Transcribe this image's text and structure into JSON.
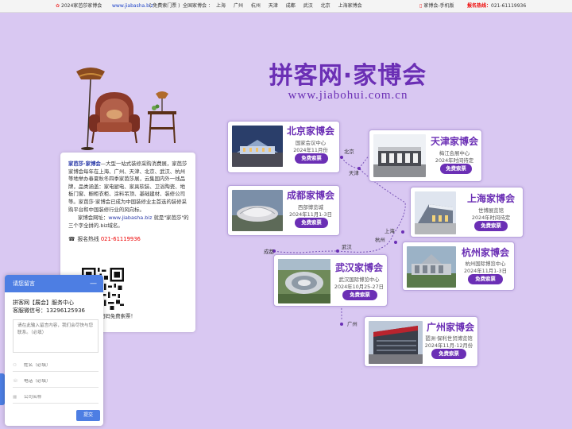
{
  "topbar": {
    "home": "2024家芭莎家博会",
    "site": "www.jiabasha.biz",
    "free": "( 免费索门票 )",
    "cities_label": "全国家博会 ：",
    "cities": [
      "上海",
      "广州",
      "杭州",
      "天津",
      "成都",
      "武汉",
      "北京",
      "上海家博会"
    ],
    "mobile": "家博会-手机版",
    "hotline_label": "报名热线：",
    "hotline_number": "021-61119936"
  },
  "hero": {
    "title": "拼客网·家博会",
    "url": "www.jiabohui.com.cn"
  },
  "about": {
    "brand": "家芭莎·家博会",
    "intro": "—大型一站式装修采购消费展，家芭莎家博会每年在上海、广州、天津、北京、武汉、杭州等地举办春夏秋冬四季家芭莎展，云集国内外一线品牌，品类涵盖：家电厨电、家具软装、卫浴陶瓷、地板门窗、橱柜衣柜、涂料吊顶、基础建材、装修公司等。家芭莎·家博会已成为中国装修业主首选的装修采购平台和中国装修行业的风向标。",
    "site_prefix": "家博会网址：",
    "site": "www.jiabasha.biz",
    "site_suffix": " 就是\"家芭莎\"的三个字全拼的.biz域名。",
    "hotline_label": "报名热线",
    "hotline_number": "021-61119936",
    "qr_caption": "扫码免费索票！"
  },
  "cards": [
    {
      "id": "beijing",
      "name": "北京家博会",
      "venue": "国家会议中心",
      "date": "2024年11月份",
      "button": "免费索票"
    },
    {
      "id": "tianjin",
      "name": "天津家博会",
      "venue": "梅江会展中心",
      "date": "2024年时间待定",
      "button": "免费索票"
    },
    {
      "id": "chengdu",
      "name": "成都家博会",
      "venue": "西部博览城",
      "date": "2024年11月1-3日",
      "button": "免费索票"
    },
    {
      "id": "shanghai",
      "name": "上海家博会",
      "venue": "世博展览馆",
      "date": "2024年时间待定",
      "button": "免费索票"
    },
    {
      "id": "hangzhou",
      "name": "杭州家博会",
      "venue": "杭州国际博览中心",
      "date": "2024年11月1-3日",
      "button": "免费索票"
    },
    {
      "id": "wuhan",
      "name": "武汉家博会",
      "venue": "武汉国际博览中心",
      "date": "2024年10月25-27日",
      "button": "免费索票"
    },
    {
      "id": "guangzhou",
      "name": "广州家博会",
      "venue": "琶洲·保利世贸博览馆",
      "date": "2024年11月-12月份",
      "button": "免费索票"
    }
  ],
  "map_labels": {
    "beijing": "北京",
    "tianjin": "天津",
    "shanghai": "上海",
    "hangzhou": "杭州",
    "wuhan": "武汉",
    "chengdu": "成都",
    "guangzhou": "广州"
  },
  "message": {
    "title": "请您留言",
    "minimize": "—",
    "org": "拼客网【展会】服务中心",
    "wechat": "客服微信号：13296125936",
    "content_placeholder": "请在此输入留言内容，我们会尽快与您联系。（必填）",
    "name_placeholder": "姓名（必填）",
    "phone_placeholder": "电话（必填）",
    "company_placeholder": "公司名称",
    "submit": "提交"
  },
  "colors": {
    "background": "#d9c8f2",
    "brand_purple": "#6b2fb5",
    "widget_blue": "#4d7ee3",
    "hotline_red": "#e00000"
  }
}
